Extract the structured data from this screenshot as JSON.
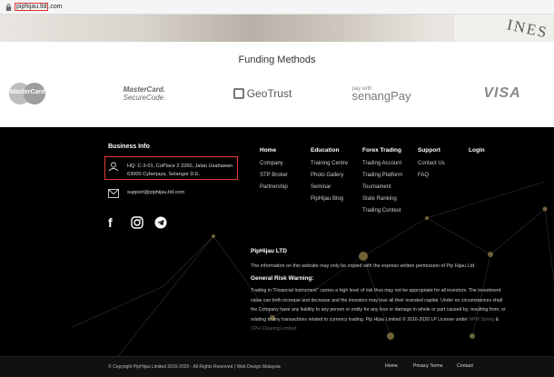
{
  "browser": {
    "url_host": "piphijau.ltd",
    "url_suffix": ".com"
  },
  "hero": {
    "watermark": "INES"
  },
  "funding": {
    "title": "Funding Methods",
    "logos": {
      "mastercard": "MasterCard",
      "mc_securecode_line1": "MasterCard.",
      "mc_securecode_line2": "SecureCode.",
      "geotrust": "GeoTrust",
      "senang_small": "pay with",
      "senang_big": "senangPay",
      "visa": "VISA"
    }
  },
  "footer": {
    "business_info": {
      "title": "Business Info",
      "address_line1": "HQ: C-3-01, CoPlace 2 2260, Jalan Usahawan",
      "address_line2": "63000 Cyberjaya, Selangor D.E.",
      "email": "support@piphijau.ltd.com"
    },
    "nav": {
      "home": {
        "title": "Home",
        "items": [
          "Company",
          "STP Broker",
          "Partnership"
        ]
      },
      "education": {
        "title": "Education",
        "items": [
          "Training Centre",
          "Photo Gallery",
          "Seminar",
          "PipHijau Blog"
        ]
      },
      "forex": {
        "title": "Forex Trading",
        "items": [
          "Trading Account",
          "Trading Platform",
          "Tournament",
          "State Ranking",
          "Trading Contest"
        ]
      },
      "support": {
        "title": "Support",
        "items": [
          "Contact Us",
          "FAQ"
        ]
      },
      "login": {
        "title": "Login"
      }
    },
    "social": {
      "facebook": "f"
    },
    "company_title": "PipHijau LTD",
    "info_line": "The information on this website may only be copied with the express written permission of Pip Hijau Ltd.",
    "risk_title": "General Risk Warning:",
    "risk_lines": [
      "Trading in \"Financial Instrument\" carries a high level of risk thus may not be appropriate for all investors. The investment",
      "value can both increase and decrease and the investors may lose all their invested capital. Under no circumstances shall",
      "the Company have any liability to any person or entity for any loss or damage in whole or part caused by, resulting from, or",
      "relating to any transactions related to currency trading. Pip Hijau Limited © 2016-2020 LP License under"
    ],
    "risk_link1": "NPM Spring",
    "risk_amp": "&",
    "risk_link2": "CPH Clearing Limited.",
    "copyright": "© Copyright PipHijau Limited 2016-2020 - All Rights Reserved | Web Design Malaysia",
    "bottom_links": {
      "home": "Home",
      "privacy": "Privacy Terms",
      "contact": "Contact"
    }
  }
}
